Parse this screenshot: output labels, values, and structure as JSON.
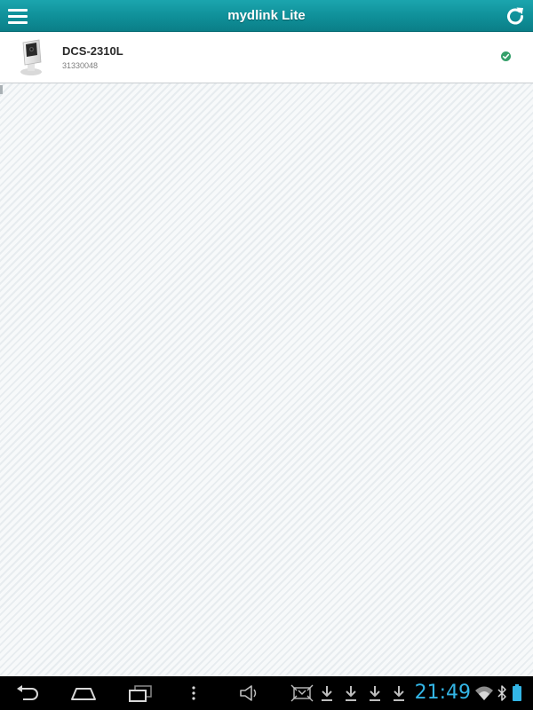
{
  "header": {
    "title": "mydlink Lite",
    "menu_icon": "hamburger-menu-icon",
    "refresh_icon": "refresh-icon",
    "accent_color": "#0f8f98"
  },
  "devices": [
    {
      "name": "DCS-2310L",
      "serial": "31330048",
      "icon": "camera-icon",
      "status_icon": "online-check-icon",
      "status_color": "#35a06a"
    }
  ],
  "navbar": {
    "back_icon": "back-icon",
    "home_icon": "home-icon",
    "recents_icon": "recent-apps-icon",
    "overflow_icon": "overflow-menu-icon",
    "status_icons": [
      "volume-icon",
      "screenshot-icon",
      "download-icon",
      "download-icon",
      "download-icon",
      "download-icon",
      "wifi-icon",
      "bluetooth-icon",
      "battery-icon"
    ],
    "clock": "21:49",
    "clock_color": "#33b5e5"
  }
}
